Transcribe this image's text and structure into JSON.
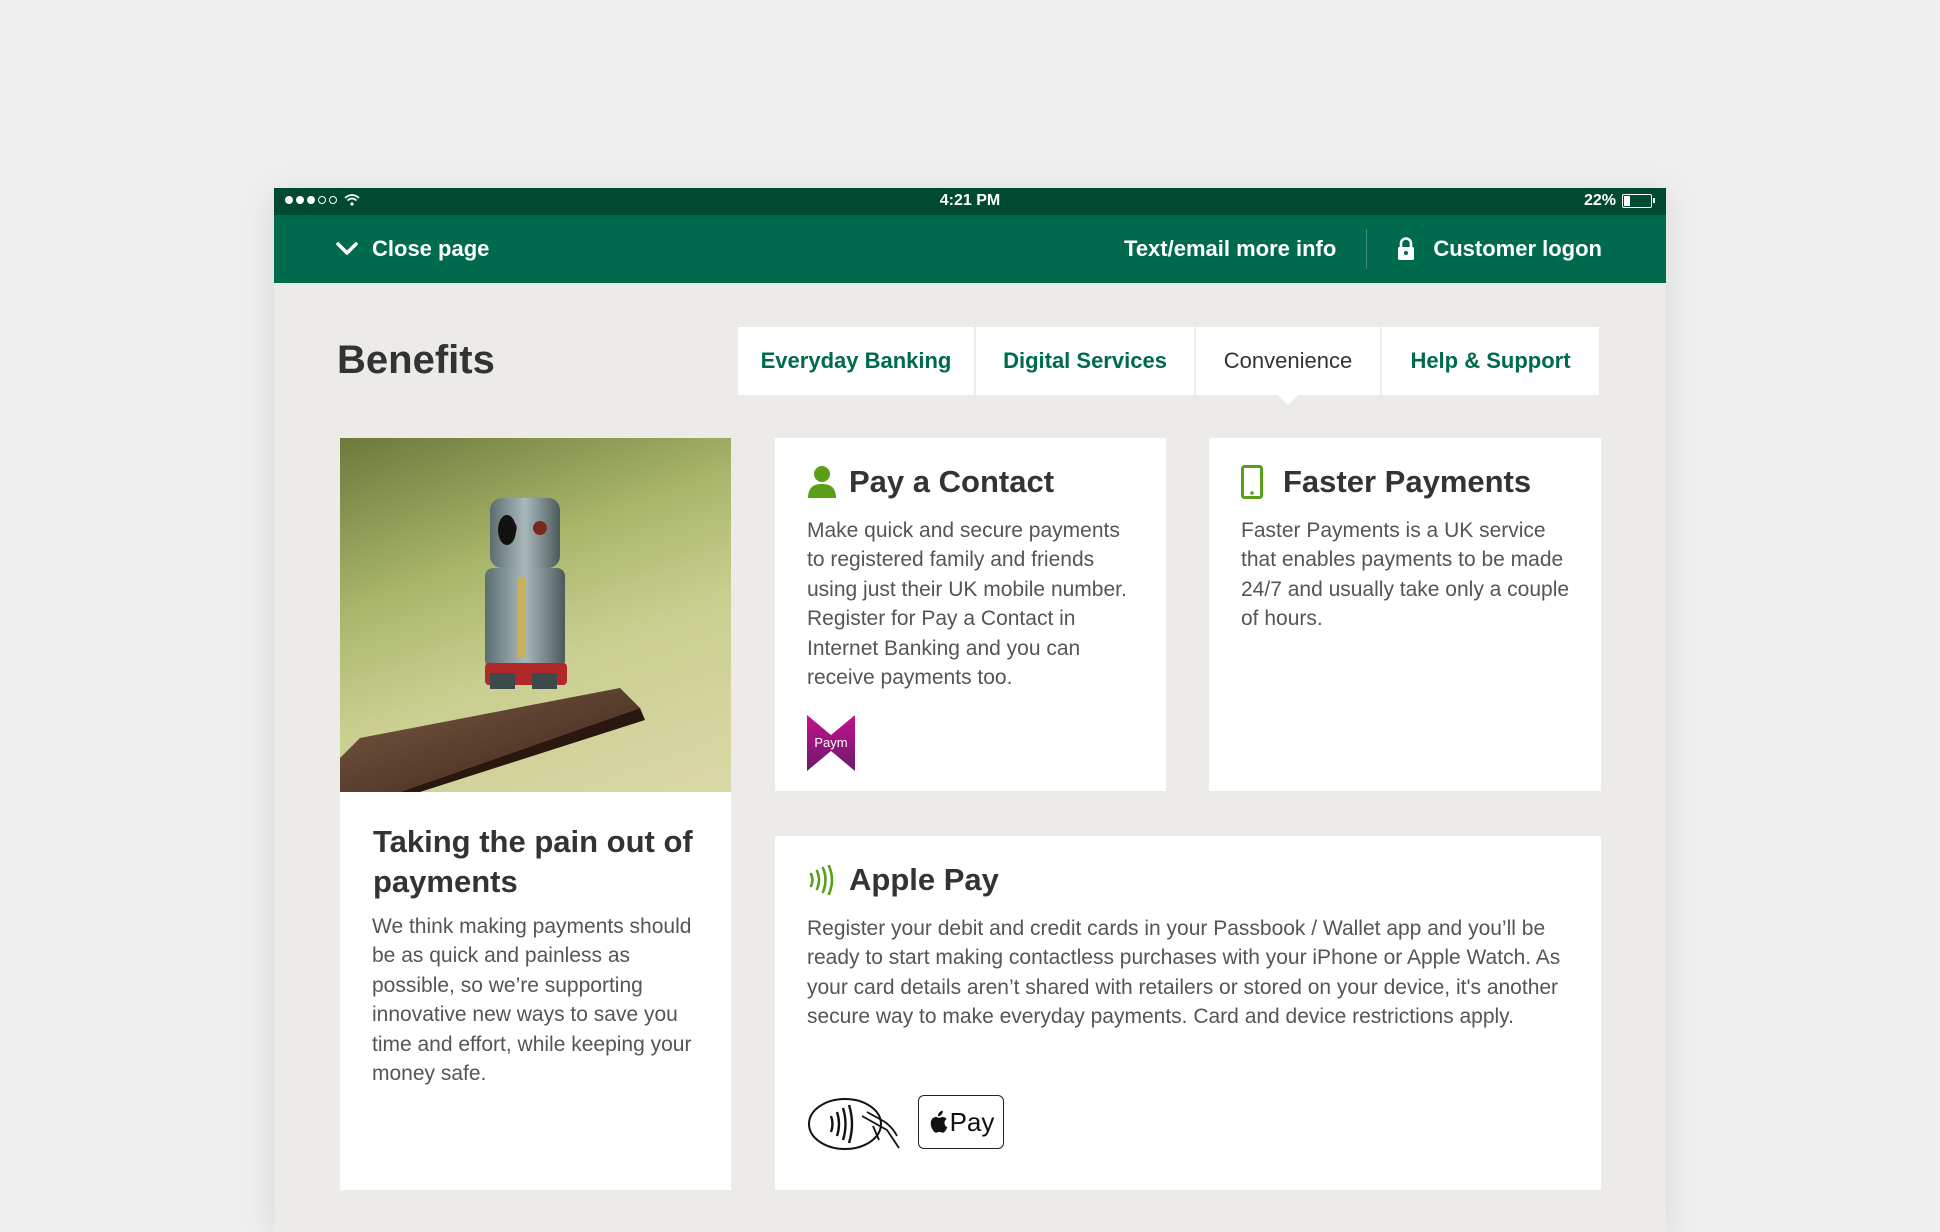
{
  "status_bar": {
    "time": "4:21 PM",
    "battery_text": "22%",
    "battery_level": 0.22
  },
  "top_nav": {
    "close_label": "Close page",
    "text_email_label": "Text/email more info",
    "customer_logon_label": "Customer logon"
  },
  "page": {
    "title": "Benefits"
  },
  "tabs": [
    {
      "label": "Everyday Banking",
      "active": false
    },
    {
      "label": "Digital Services",
      "active": false
    },
    {
      "label": "Convenience",
      "active": true
    },
    {
      "label": "Help & Support",
      "active": false
    }
  ],
  "hero_card": {
    "title": "Taking the pain out of payments",
    "body": "We think making payments should be as quick and painless as possible, so we’re supporting innovative new ways to save you time and effort, while keeping your money safe."
  },
  "pay_contact_card": {
    "title": "Pay a Contact",
    "body": "Make quick and secure payments to registered family and friends using just their UK mobile number. Register for Pay a Contact in Internet Banking and you can receive payments too.",
    "logo_text": "Paym",
    "icon": "person-icon"
  },
  "faster_payments_card": {
    "title": "Faster Payments",
    "body": "Faster Payments is a UK service that enables payments to be made 24/7 and usually take only a couple of hours.",
    "icon": "mobile-phone-icon"
  },
  "apple_pay_card": {
    "title": "Apple Pay",
    "body": "Register your debit and credit cards in your Passbook / Wallet app and you’ll be ready to start making contactless purchases with your iPhone or Apple Watch. As your card details aren’t shared with retailers or stored on your device, it's another secure way to make everyday payments. Card and device restrictions apply.",
    "badge_text": "Pay",
    "icon": "contactless-icon"
  },
  "colors": {
    "brand_green": "#006a4d",
    "status_green": "#004a32",
    "accent_green": "#5a9e1a",
    "page_bg": "#ecebe8"
  }
}
